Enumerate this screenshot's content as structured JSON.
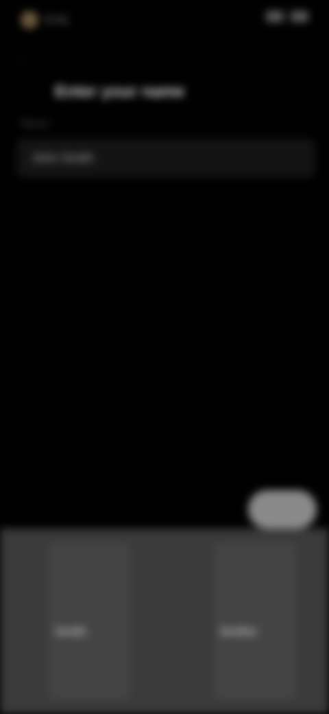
{
  "status": {
    "time": "9:41",
    "icons": [
      "signal-icon",
      "wifi-icon",
      "battery-icon"
    ]
  },
  "header": {
    "back_icon": "back-arrow-icon",
    "title": "Enter your name"
  },
  "form": {
    "label": "Name",
    "value": "John Smith"
  },
  "send_button": {
    "label": ""
  },
  "keyboard": {
    "suggestions": [
      "Smith",
      "Smiths"
    ]
  },
  "colors": {
    "background": "#000000",
    "keyboard": "#3a3a3a",
    "button": "#8a8a8a"
  }
}
